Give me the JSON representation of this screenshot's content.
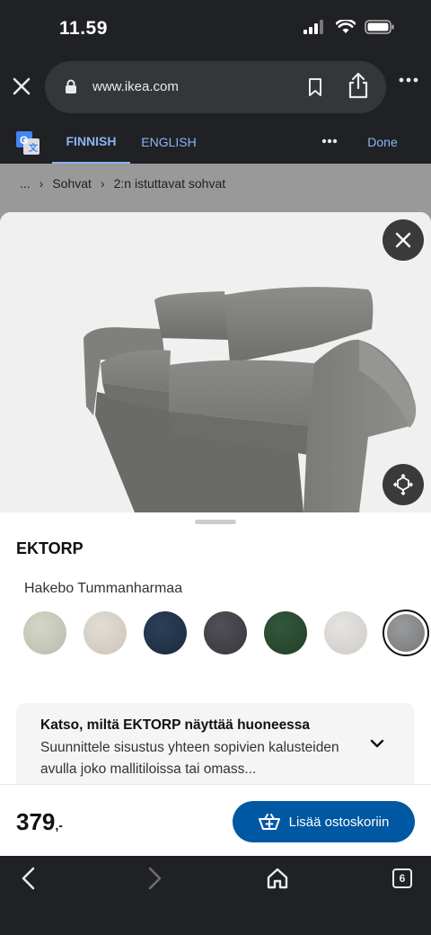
{
  "status": {
    "time": "11.59"
  },
  "browser": {
    "url": "www.ikea.com",
    "icons": [
      "close-icon",
      "lock-icon",
      "bookmark-icon",
      "share-icon",
      "more-icon"
    ]
  },
  "translate": {
    "tab_finnish": "FINNISH",
    "tab_english": "ENGLISH",
    "done": "Done"
  },
  "breadcrumb": {
    "ellipsis": "...",
    "items": [
      "Sohvat",
      "2:n istuttavat sohvat"
    ]
  },
  "product": {
    "name": "EKTORP",
    "color_name": "Hakebo Tummanharmaa",
    "swatches": [
      {
        "color": "#c9cbbd",
        "selected": false
      },
      {
        "color": "#d9d3cb",
        "selected": false
      },
      {
        "color": "#22344a",
        "selected": false
      },
      {
        "color": "#45434a",
        "selected": false
      },
      {
        "color": "#2a4a32",
        "selected": false
      },
      {
        "color": "#dcdad8",
        "selected": false
      },
      {
        "color": "#87888a",
        "selected": true
      }
    ]
  },
  "ar_card": {
    "title": "Katso, miltä EKTORP näyttää huoneessa",
    "description": "Suunnittele sisustus yhteen sopivien kalusteiden avulla joko mallitiloissa tai omass..."
  },
  "purchase": {
    "price": "379",
    "price_suffix": ",-",
    "add_to_cart": "Lisää ostoskoriin",
    "accent": "#0058a3"
  },
  "nav": {
    "tab_count": "6"
  }
}
